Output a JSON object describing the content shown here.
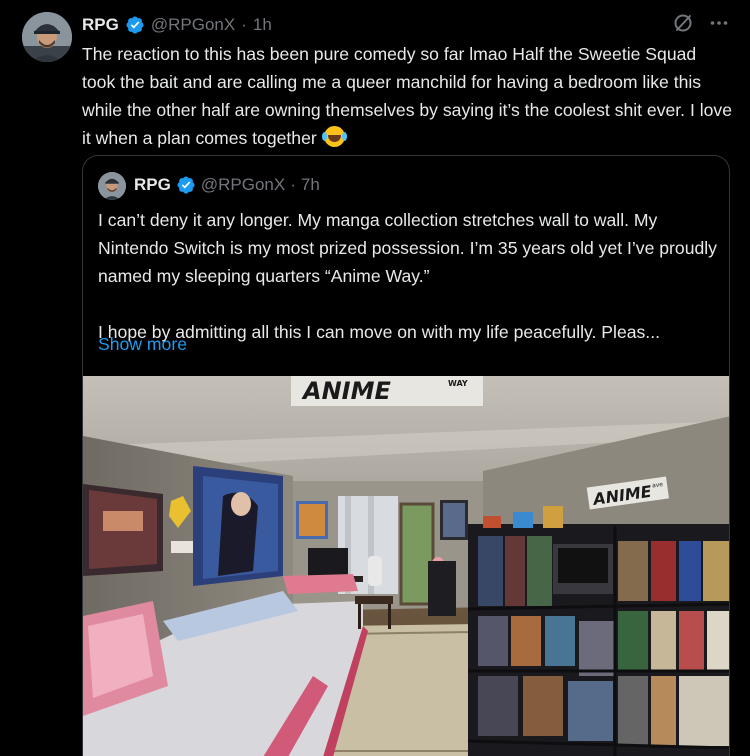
{
  "tweet": {
    "author_name": "RPG",
    "handle": "@RPGonX",
    "separator": "·",
    "time": "1h",
    "text": "The reaction to this has been pure comedy so far lmao Half the Sweetie Squad took the bait and are calling me a queer manchild for having a bedroom like this while the other half are owning themselves by saying it’s the coolest shit ever. I love it when a plan comes together",
    "emoji_icon": "face-with-tears-of-joy-icon"
  },
  "quoted": {
    "author_name": "RPG",
    "handle": "@RPGonX",
    "separator": "·",
    "time": "7h",
    "paragraph1": "I can’t deny it any longer. My manga collection stretches wall to wall. My Nintendo Switch is my most prized possession. I’m 35 years old yet I’ve proudly named my sleeping quarters “Anime Way.”",
    "paragraph2": "I hope by admitting all this I can move on with my life peacefully. Pleas...",
    "show_more": "Show more",
    "photo": {
      "sign_main": "ANIME",
      "sign_sub": "WAY",
      "sign_right_main": "ANIME",
      "sign_right_sub": "ave"
    }
  },
  "colors": {
    "background": "#000000",
    "text_primary": "#e7e9ea",
    "text_secondary": "#71767b",
    "link": "#1d9bf0",
    "verified": "#1d9bf0",
    "border": "#333639"
  },
  "icons": [
    "verified-badge-icon",
    "grok-icon",
    "more-icon",
    "avatar"
  ]
}
